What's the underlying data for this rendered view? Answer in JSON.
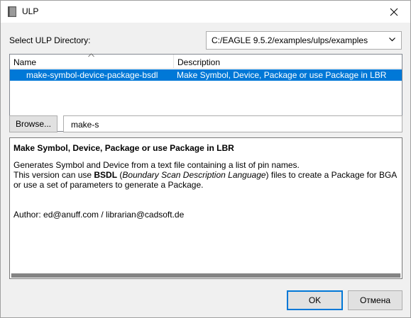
{
  "window": {
    "title": "ULP"
  },
  "directory": {
    "label": "Select ULP Directory:",
    "selected": "C:/EAGLE 9.5.2/examples/ulps/examples"
  },
  "list": {
    "columns": [
      "Name",
      "Description"
    ],
    "rows": [
      {
        "name": "make-symbol-device-package-bsdl",
        "description": "Make Symbol, Device, Package or use Package in LBR",
        "selected": true
      }
    ]
  },
  "browse": {
    "label": "Browse..."
  },
  "filter": {
    "value": "make-s"
  },
  "description": {
    "title": "Make Symbol, Device, Package or use Package in LBR",
    "line1": "Generates Symbol and Device from a text file containing a list of pin names.",
    "line2_pre": "This version can use ",
    "line2_bold": "BSDL",
    "line2_mid": " (",
    "line2_italic": "Boundary Scan Description Language",
    "line2_post": ") files to create a Package for BGA",
    "line3": "or use a set of parameters to generate a Package.",
    "author": "Author: ed@anuff.com / librarian@cadsoft.de"
  },
  "buttons": {
    "ok": "OK",
    "cancel": "Отмена"
  },
  "colors": {
    "accent": "#0078d7"
  }
}
